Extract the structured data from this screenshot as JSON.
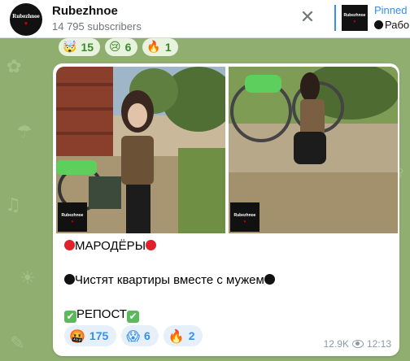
{
  "header": {
    "channel_title": "Rubezhnoe",
    "subscribers": "14 795 subscribers",
    "avatar_text": "Rubezhnoe",
    "close_icon": "close-icon"
  },
  "pinned": {
    "label": "Pinned",
    "text": "Рабо",
    "thumb_text": "Rubezhnoe"
  },
  "prev_reactions": [
    {
      "emoji": "🤯",
      "count": "15"
    },
    {
      "emoji": "😢",
      "count": "6"
    },
    {
      "emoji": "🔥",
      "count": "1"
    }
  ],
  "message": {
    "photo_watermark": "Rubezhnoe",
    "line1": "МАРОДЁРЫ",
    "line2": "Чистят квартиры вместе с мужем",
    "line3": "РЕПОСТ",
    "reactions": [
      {
        "emoji": "🤬",
        "count": "175"
      },
      {
        "emoji": "😱",
        "count": "6"
      },
      {
        "emoji": "🔥",
        "count": "2"
      }
    ],
    "views": "12.9K",
    "time": "12:13"
  },
  "colors": {
    "accent": "#3390ec",
    "wallpaper": "#8fae6f",
    "reaction_bg": "#e5f0fb",
    "red_circle": "#e0202a",
    "check_green": "#5cb85c"
  }
}
